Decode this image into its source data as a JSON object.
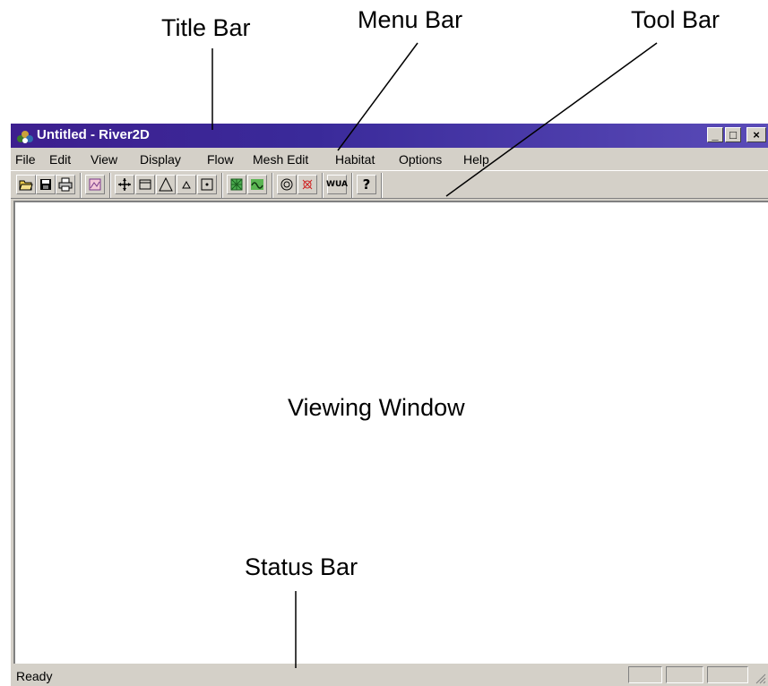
{
  "callouts": {
    "title_bar": "Title Bar",
    "menu_bar": "Menu Bar",
    "tool_bar": "Tool Bar",
    "viewing_window": "Viewing Window",
    "status_bar": "Status Bar"
  },
  "window": {
    "title": "Untitled - River2D",
    "controls": {
      "minimize": "_",
      "maximize": "□",
      "close": "×"
    },
    "title_gradient": [
      "#3d1f8f",
      "#5a4bb8"
    ]
  },
  "menu": {
    "items": [
      "File",
      "Edit",
      "View",
      "Display",
      "Flow",
      "Mesh Edit",
      "Habitat",
      "Options",
      "Help"
    ]
  },
  "toolbar": {
    "buttons": [
      {
        "icon": "open-folder-icon"
      },
      {
        "icon": "save-disk-icon"
      },
      {
        "icon": "print-icon"
      },
      {
        "icon": "bed-file-icon"
      },
      {
        "icon": "move-arrows-icon"
      },
      {
        "icon": "rectangle-select-icon"
      },
      {
        "icon": "triangle-icon"
      },
      {
        "icon": "small-triangle-icon"
      },
      {
        "icon": "node-box-icon"
      },
      {
        "icon": "mesh-green-icon"
      },
      {
        "icon": "flow-wave-icon"
      },
      {
        "icon": "target-circle-icon"
      },
      {
        "icon": "red-target-icon"
      },
      {
        "icon": "wua-icon",
        "label": "WUA"
      },
      {
        "icon": "help-question-icon",
        "label": "?"
      }
    ]
  },
  "status": {
    "text": "Ready"
  }
}
